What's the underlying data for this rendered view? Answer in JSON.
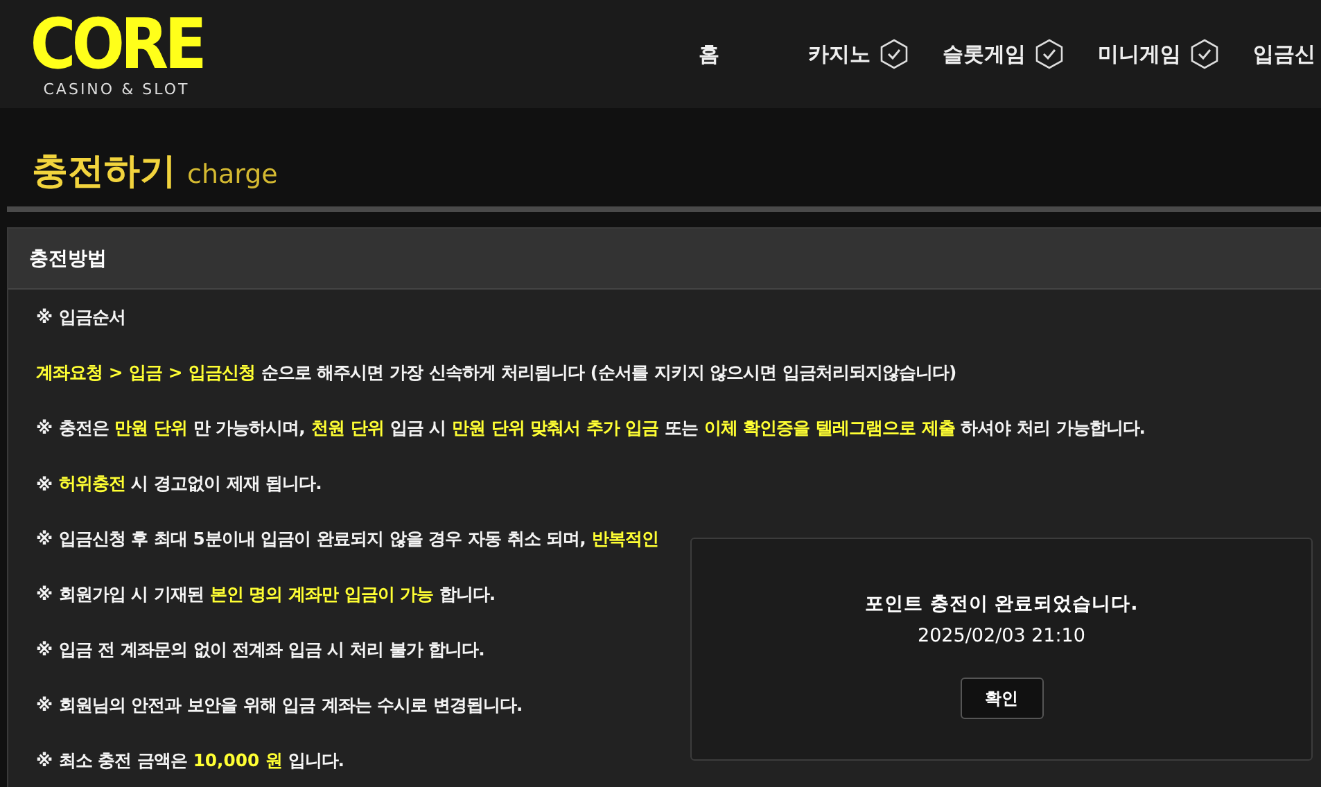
{
  "header": {
    "logo": {
      "wordmark": "CORE",
      "tagline": "CASINO & SLOT"
    },
    "nav": [
      {
        "label": "홈",
        "has_icon": false
      },
      {
        "label": "카지노",
        "has_icon": true
      },
      {
        "label": "슬롯게임",
        "has_icon": true
      },
      {
        "label": "미니게임",
        "has_icon": true
      },
      {
        "label": "입금신",
        "has_icon": false
      }
    ]
  },
  "page_title": {
    "title": "충전하기",
    "subtitle": "charge"
  },
  "panel": {
    "title": "충전방법",
    "lines": [
      [
        {
          "text": "※ 입금순서",
          "highlight": false
        }
      ],
      [
        {
          "text": "계좌요청 > 입금 > 입금신청",
          "highlight": true
        },
        {
          "text": " 순으로 해주시면 가장 신속하게 처리됩니다 (순서를 지키지 않으시면 입금처리되지않습니다)",
          "highlight": false
        }
      ],
      [
        {
          "text": "※ 충전은 ",
          "highlight": false
        },
        {
          "text": "만원 단위",
          "highlight": true
        },
        {
          "text": " 만 가능하시며, ",
          "highlight": false
        },
        {
          "text": "천원 단위",
          "highlight": true
        },
        {
          "text": " 입금 시 ",
          "highlight": false
        },
        {
          "text": "만원 단위 맞춰서 추가 입금",
          "highlight": true
        },
        {
          "text": " 또는 ",
          "highlight": false
        },
        {
          "text": "이체 확인증을 텔레그램으로 제출",
          "highlight": true
        },
        {
          "text": " 하셔야 처리 가능합니다.",
          "highlight": false
        }
      ],
      [
        {
          "text": "※ ",
          "highlight": false
        },
        {
          "text": "허위충전",
          "highlight": true
        },
        {
          "text": " 시 경고없이 제재 됩니다.",
          "highlight": false
        }
      ],
      [
        {
          "text": "※ 입금신청 후 최대 5분이내 입금이 완료되지 않을 경우 자동 취소 되며, ",
          "highlight": false
        },
        {
          "text": "반복적인",
          "highlight": true
        }
      ],
      [
        {
          "text": "※ 회원가입 시 기재된 ",
          "highlight": false
        },
        {
          "text": "본인 명의 계좌만 입금이 가능",
          "highlight": true
        },
        {
          "text": " 합니다.",
          "highlight": false
        }
      ],
      [
        {
          "text": "※ 입금 전 계좌문의 없이 전계좌 입금 시 처리 불가 합니다.",
          "highlight": false
        }
      ],
      [
        {
          "text": "※ 회원님의 안전과 보안을 위해 입금 계좌는 수시로 변경됩니다.",
          "highlight": false
        }
      ],
      [
        {
          "text": "※ 최소 충전 금액은 ",
          "highlight": false
        },
        {
          "text": "10,000 원",
          "highlight": true
        },
        {
          "text": " 입니다.",
          "highlight": false
        }
      ]
    ]
  },
  "dialog": {
    "message": "포인트 충전이 완료되었습니다.",
    "timestamp": "2025/02/03 21:10",
    "button": "확인"
  }
}
